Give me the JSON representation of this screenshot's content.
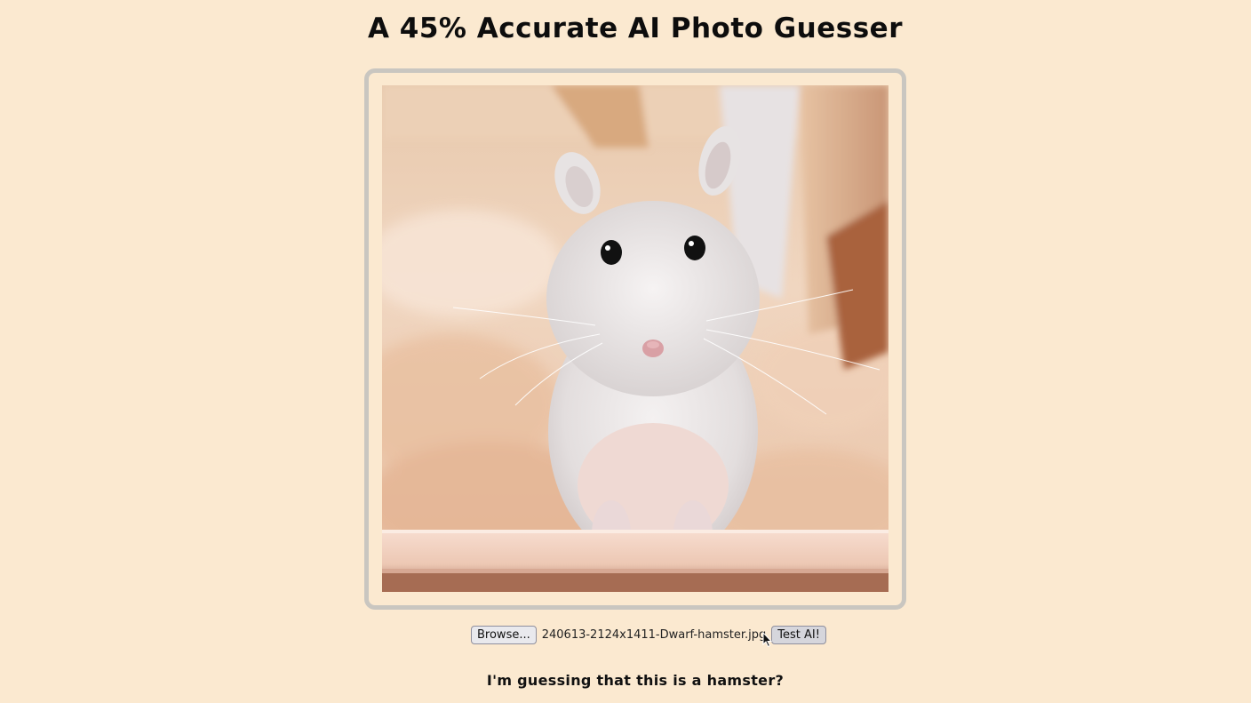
{
  "page": {
    "title": "A 45% Accurate AI Photo Guesser",
    "background_color": "#fbe9d0"
  },
  "photo": {
    "alt": "Dwarf hamster photo"
  },
  "upload": {
    "browse_label": "Browse...",
    "selected_file": "240613-2124x1411-Dwarf-hamster.jpg",
    "test_label": "Test AI!"
  },
  "result": {
    "text": "I'm guessing that this is a hamster?"
  },
  "icons": {
    "cursor": "mouse-pointer-icon"
  }
}
